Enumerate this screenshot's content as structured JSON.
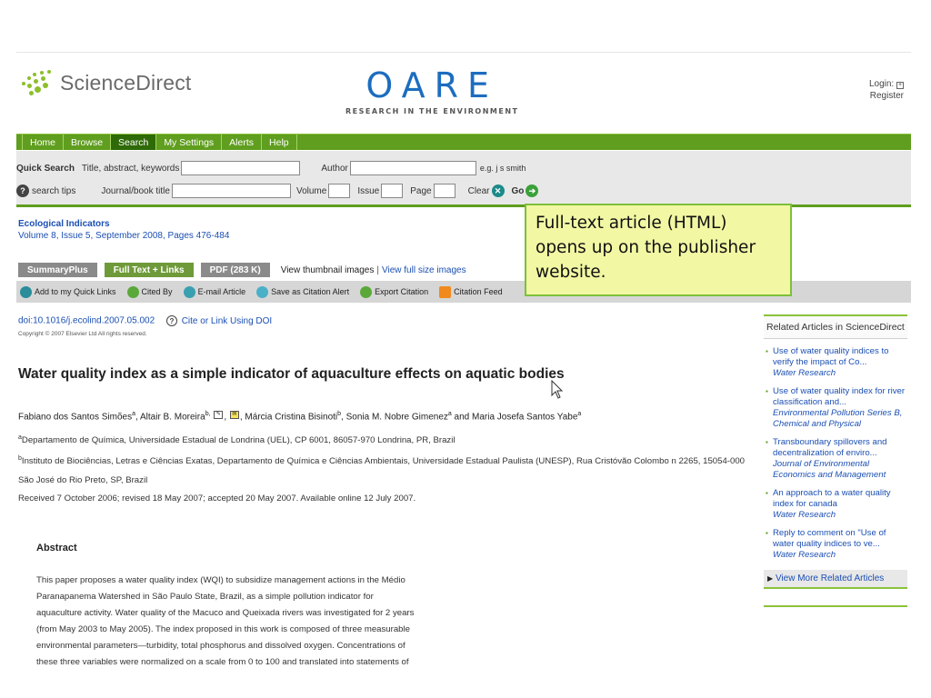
{
  "header": {
    "brand": "ScienceDirect",
    "oare_title": "OARE",
    "oare_subtitle": "RESEARCH IN THE ENVIRONMENT",
    "login": "Login:",
    "register": "Register"
  },
  "nav": [
    "Home",
    "Browse",
    "Search",
    "My Settings",
    "Alerts",
    "Help"
  ],
  "quick_search": {
    "label": "Quick Search",
    "field1": "Title, abstract, keywords",
    "author": "Author",
    "example": "e.g. j s smith",
    "search_tips": "search tips",
    "journal": "Journal/book title",
    "volume": "Volume",
    "issue": "Issue",
    "page": "Page",
    "clear": "Clear",
    "go": "Go"
  },
  "journal": {
    "name": "Ecological Indicators",
    "volume_line": "Volume 8, Issue 5, September 2008, Pages 476-484"
  },
  "view_tabs": {
    "summary": "SummaryPlus",
    "fulltext": "Full Text + Links",
    "pdf": "PDF (283 K)",
    "view_thumbs": "View thumbnail images",
    "separator": "|",
    "view_full": "View full size images"
  },
  "tools": [
    "Add to my Quick Links",
    "Cited By",
    "E-mail Article",
    "Save as Citation Alert",
    "Export Citation",
    "Citation Feed"
  ],
  "article": {
    "doi": "doi:10.1016/j.ecolind.2007.05.002",
    "cite_link": "Cite or Link Using DOI",
    "copyright": "Copyright © 2007 Elsevier Ltd All rights reserved.",
    "title": "Water quality index as a simple indicator of aquaculture effects on aquatic bodies",
    "authors": {
      "a1": "Fabiano dos Santos Simões",
      "a1_sup": "a",
      "a2": ", Altair B. Moreira",
      "a2_sup": "b,",
      "sep": ", ",
      "a3": ", Márcia Cristina Bisinoti",
      "a3_sup": "b",
      "a4": ", Sonia M. Nobre Gimenez",
      "a4_sup": "a",
      "a5": " and Maria Josefa Santos Yabe",
      "a5_sup": "a"
    },
    "aff_a_sup": "a",
    "aff_a": "Departamento de Química, Universidade Estadual de Londrina (UEL), CP 6001, 86057-970 Londrina, PR, Brazil",
    "aff_b_sup": "b",
    "aff_b": "Instituto de Biociências, Letras e Ciências Exatas, Departamento de Química e Ciências Ambientais, Universidade Estadual Paulista (UNESP), Rua Cristóvão Colombo n 2265, 15054-000",
    "aff_b2": "São José do Rio Preto, SP, Brazil",
    "received": "Received 7 October 2006;  revised 18 May 2007;  accepted 20 May 2007.  Available online 12 July 2007.",
    "abstract_heading": "Abstract",
    "abstract_lines": [
      "This paper proposes a water quality index (WQI) to subsidize management actions in the Médio",
      "Paranapanema Watershed in São Paulo State, Brazil, as a simple pollution indicator for",
      "aquaculture activity. Water quality of the Macuco and Queixada rivers was investigated for 2 years",
      "(from May 2003 to May 2005). The index proposed in this work is composed of three measurable",
      "environmental parameters—turbidity, total phosphorus and dissolved oxygen. Concentrations of",
      "these three variables were normalized on a scale from 0 to 100 and translated into statements of"
    ]
  },
  "callout": "Full-text article (HTML) opens up on the publisher website.",
  "related": {
    "heading": "Related Articles in ScienceDirect",
    "items": [
      {
        "title": "Use of water quality indices to verify the impact of Co...",
        "journal": "Water Research"
      },
      {
        "title": "Use of water quality index for river classification and...",
        "journal": "Environmental Pollution Series B, Chemical and Physical"
      },
      {
        "title": "Transboundary spillovers and decentralization of enviro...",
        "journal": "Journal of Environmental Economics and Management"
      },
      {
        "title": "An approach to a water quality index for canada",
        "journal": "Water Research"
      },
      {
        "title": "Reply to comment on \"Use of water quality indices to ve...",
        "journal": "Water Research"
      }
    ],
    "view_more": "View More Related Articles"
  },
  "colors": {
    "nav_green": "#5f9e1e",
    "link_blue": "#1b4fb3",
    "callout_bg": "#f2f7a3"
  }
}
